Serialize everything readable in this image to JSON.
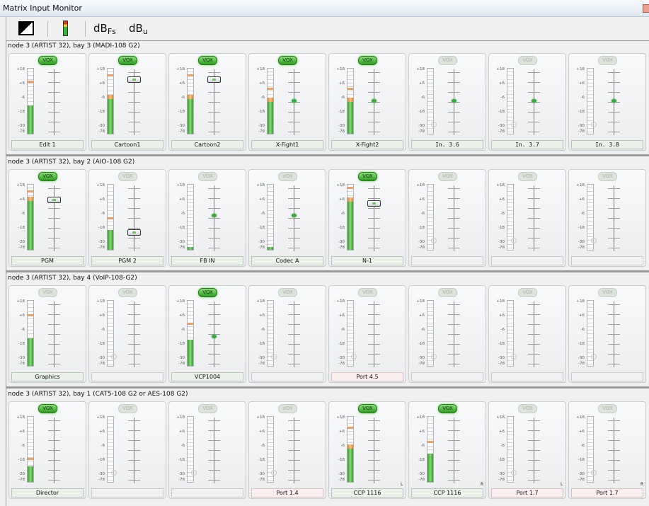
{
  "window": {
    "title": "Matrix Input Monitor"
  },
  "toolbar": {
    "icons": [
      "contrast-toggle-icon",
      "level-meter-icon"
    ],
    "unit_dbfs": {
      "main": "dB",
      "sub": "Fs"
    },
    "unit_dbu": {
      "main": "dB",
      "sub": "u"
    }
  },
  "scale_labels": [
    "+18",
    "+6",
    "-6",
    "-18",
    "-30",
    "-78"
  ],
  "vox_label": "VOX",
  "groups": [
    {
      "header": "node 3 (ARTIST 32), bay 3 (MADI-108 G2)",
      "channels": [
        {
          "name": "Edit 1",
          "vox": true,
          "level": 0.44,
          "fader": null,
          "peak": 0.78,
          "mono": false
        },
        {
          "name": "Cartoon1",
          "vox": true,
          "level": 0.6,
          "fader": 0.83,
          "peak": 0.88,
          "mono": false
        },
        {
          "name": "Cartoon2",
          "vox": true,
          "level": 0.6,
          "fader": 0.83,
          "peak": 0.88,
          "mono": false
        },
        {
          "name": "X-Fight1",
          "vox": true,
          "level": 0.55,
          "fader": 0.51,
          "peak": 0.67,
          "mono": false
        },
        {
          "name": "X-Fight2",
          "vox": true,
          "level": 0.55,
          "fader": 0.51,
          "peak": 0.67,
          "mono": false
        },
        {
          "name": "In. 3.6",
          "vox": false,
          "level": 0,
          "fader": 0.51,
          "peak": null,
          "mono": true
        },
        {
          "name": "In. 3.7",
          "vox": false,
          "level": 0,
          "fader": 0.51,
          "peak": null,
          "mono": true
        },
        {
          "name": "In. 3.8",
          "vox": false,
          "level": 0,
          "fader": 0.51,
          "peak": null,
          "mono": true
        }
      ]
    },
    {
      "header": "node 3 (ARTIST 32), bay 2 (AIO-108 G2)",
      "channels": [
        {
          "name": "PGM",
          "vox": true,
          "level": 0.82,
          "fader": 0.77,
          "peak": 0.88,
          "mono": false
        },
        {
          "name": "PGM 2",
          "vox": false,
          "level": 0.3,
          "fader": 0.28,
          "peak": 0.47,
          "mono": false
        },
        {
          "name": "FB IN",
          "vox": false,
          "level": 0.04,
          "fader": 0.53,
          "peak": null,
          "mono": false
        },
        {
          "name": "Codec A",
          "vox": false,
          "level": 0.04,
          "fader": 0.53,
          "peak": null,
          "mono": false
        },
        {
          "name": "N-1",
          "vox": true,
          "level": 0.8,
          "fader": 0.71,
          "peak": 0.93,
          "mono": false
        },
        {
          "name": "",
          "vox": false,
          "level": 0,
          "fader": null,
          "peak": null,
          "mono": false
        },
        {
          "name": "",
          "vox": false,
          "level": 0,
          "fader": null,
          "peak": null,
          "mono": false
        },
        {
          "name": "",
          "vox": false,
          "level": 0,
          "fader": null,
          "peak": null,
          "mono": false
        }
      ]
    },
    {
      "header": "node 3 (ARTIST 32), bay 4 (VoIP-108-G2)",
      "channels": [
        {
          "name": "Graphics",
          "vox": false,
          "level": 0.42,
          "fader": null,
          "peak": 0.76,
          "mono": false
        },
        {
          "name": "",
          "vox": false,
          "level": 0,
          "fader": null,
          "peak": null,
          "mono": false
        },
        {
          "name": "VCP1004",
          "vox": true,
          "level": 0.4,
          "fader": 0.46,
          "peak": 0.63,
          "mono": false
        },
        {
          "name": "",
          "vox": false,
          "level": 0,
          "fader": null,
          "peak": null,
          "mono": false
        },
        {
          "name": "Port 4.5",
          "vox": false,
          "level": 0,
          "fader": null,
          "peak": null,
          "mono": false
        },
        {
          "name": "",
          "vox": false,
          "level": 0,
          "fader": null,
          "peak": null,
          "mono": false
        },
        {
          "name": "",
          "vox": false,
          "level": 0,
          "fader": null,
          "peak": null,
          "mono": false
        },
        {
          "name": "",
          "vox": false,
          "level": 0,
          "fader": null,
          "peak": null,
          "mono": false
        }
      ]
    },
    {
      "header": "node 3 (ARTIST 32), bay 1 (CAT5-108 G2 or AES-108 G2)",
      "channels": [
        {
          "name": "Director",
          "vox": true,
          "level": 0.24,
          "fader": null,
          "peak": 0.34,
          "mono": false
        },
        {
          "name": "",
          "vox": false,
          "level": 0,
          "fader": null,
          "peak": null,
          "mono": false
        },
        {
          "name": "",
          "vox": false,
          "level": 0,
          "fader": null,
          "peak": null,
          "mono": false
        },
        {
          "name": "Port 1.4",
          "vox": false,
          "level": 0,
          "fader": null,
          "peak": null,
          "mono": false
        },
        {
          "name": "CCP 1116",
          "vox": true,
          "level": 0.58,
          "fader": null,
          "peak": 0.82,
          "mono": false,
          "side": "L"
        },
        {
          "name": "CCP 1116",
          "vox": true,
          "level": 0.44,
          "fader": null,
          "peak": 0.6,
          "mono": false,
          "side": "R"
        },
        {
          "name": "Port 1.7",
          "vox": false,
          "level": 0,
          "fader": null,
          "peak": null,
          "mono": false,
          "side": "L"
        },
        {
          "name": "Port 1.7",
          "vox": false,
          "level": 0,
          "fader": null,
          "peak": null,
          "mono": false,
          "side": "R"
        }
      ]
    }
  ]
}
